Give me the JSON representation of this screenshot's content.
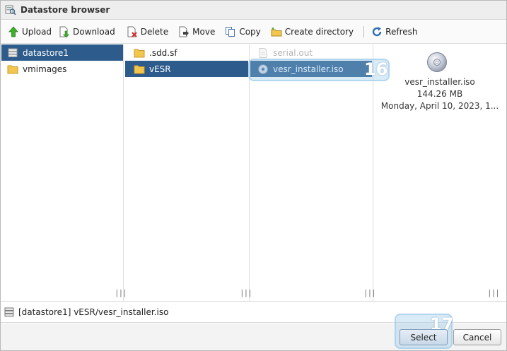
{
  "window": {
    "title": "Datastore browser"
  },
  "toolbar": {
    "upload": "Upload",
    "download": "Download",
    "delete": "Delete",
    "move": "Move",
    "copy": "Copy",
    "create_directory": "Create directory",
    "refresh": "Refresh"
  },
  "datastores": [
    {
      "label": "datastore1",
      "selected": true
    },
    {
      "label": "vmimages",
      "selected": false
    }
  ],
  "folders": [
    {
      "label": ".sdd.sf",
      "selected": false
    },
    {
      "label": "vESR",
      "selected": true
    }
  ],
  "files": [
    {
      "label": "serial.out",
      "disabled": true
    },
    {
      "label": "vesr_installer.iso",
      "selected": true
    }
  ],
  "preview": {
    "name": "vesr_installer.iso",
    "size": "144.26 MB",
    "date": "Monday, April 10, 2023, 1..."
  },
  "path": "[datastore1] vESR/vesr_installer.iso",
  "footer": {
    "select": "Select",
    "cancel": "Cancel"
  },
  "steps": {
    "file_step": "16",
    "select_step": "17"
  },
  "colors": {
    "selection": "#2c5b8c",
    "highlight": "#92c5e8",
    "folder": "#f2c64d"
  }
}
